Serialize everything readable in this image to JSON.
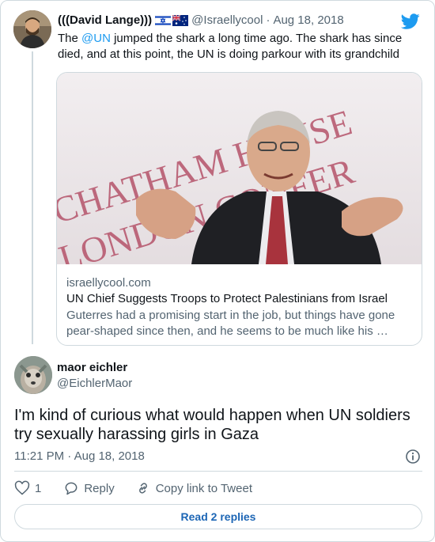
{
  "parent_tweet": {
    "author_name": "(((David Lange)))",
    "author_handle": "@Israellycool",
    "separator": "·",
    "date": "Aug 18, 2018",
    "text_before": "The ",
    "mention": "@UN",
    "text_after": " jumped the shark a long time ago. The shark has since died, and at this point, the UN is doing parkour with its grandchild",
    "link_card": {
      "image_lines": [
        "CHATHAM HOUSE",
        "LONDON CONFER"
      ],
      "domain": "israellycool.com",
      "title": "UN Chief Suggests Troops to Protect Palestinians from Israel",
      "description": "Guterres had a promising start in the job, but things have gone pear-shaped since then, and he seems to be much like his …"
    }
  },
  "main_tweet": {
    "author_name": "maor eichler",
    "author_handle": "@EichlerMaor",
    "text": "I'm kind of curious what would happen when UN soldiers try sexually harassing girls in Gaza",
    "timestamp": "11:21 PM · Aug 18, 2018"
  },
  "actions": {
    "like_count": "1",
    "reply_label": "Reply",
    "copy_link_label": "Copy link to Tweet"
  },
  "read_replies_label": "Read 2 replies",
  "icons": [
    "israel-flag-icon",
    "australia-flag-icon",
    "twitter-logo-icon",
    "info-icon",
    "heart-icon",
    "reply-bubble-icon",
    "link-icon"
  ],
  "colors": {
    "accent": "#1d9bf0",
    "read_replies_text": "#1d66b5",
    "secondary_text": "#536471",
    "border": "#cfd9de"
  }
}
